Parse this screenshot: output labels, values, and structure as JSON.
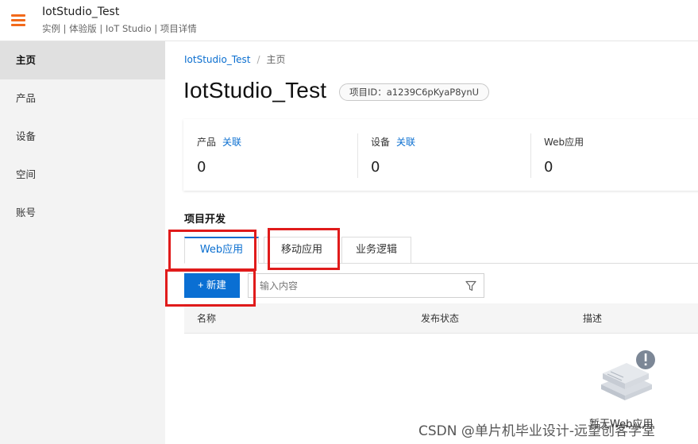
{
  "header": {
    "app_title": "IotStudio_Test",
    "sub_crumb": "实例 | 体验版 | IoT Studio | 项目详情"
  },
  "sidebar": {
    "items": [
      {
        "label": "主页"
      },
      {
        "label": "产品"
      },
      {
        "label": "设备"
      },
      {
        "label": "空间"
      },
      {
        "label": "账号"
      }
    ]
  },
  "breadcrumb": {
    "project": "IotStudio_Test",
    "separator": "/",
    "current": "主页"
  },
  "page": {
    "title": "IotStudio_Test",
    "project_id": "项目ID：a1239C6pKyaP8ynU"
  },
  "stats": [
    {
      "label": "产品",
      "link": "关联",
      "value": "0"
    },
    {
      "label": "设备",
      "link": "关联",
      "value": "0"
    },
    {
      "label": "Web应用",
      "link": "",
      "value": "0"
    }
  ],
  "project_dev": {
    "title": "项目开发",
    "tabs": [
      {
        "label": "Web应用",
        "active": true
      },
      {
        "label": "移动应用",
        "active": false
      },
      {
        "label": "业务逻辑",
        "active": false
      }
    ],
    "new_button": "+ 新建",
    "search_placeholder": "输入内容",
    "columns": [
      "名称",
      "发布状态",
      "描述"
    ],
    "empty_text": "暂无Web应用"
  },
  "watermark": "CSDN @单片机毕业设计-远望创客学堂",
  "colors": {
    "accent": "#0b6fd0",
    "brand_orange": "#f26a1b",
    "annotation_red": "#e01b1b"
  }
}
